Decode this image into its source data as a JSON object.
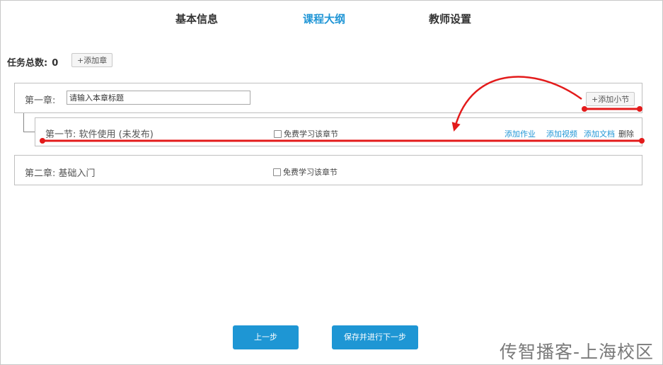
{
  "tabs": {
    "basic": "基本信息",
    "outline": "课程大纲",
    "teacher": "教师设置"
  },
  "summary": {
    "label": "任务总数:",
    "count": "0",
    "add_chapter": "+添加章"
  },
  "chapter1": {
    "label": "第一章:",
    "title_placeholder": "请输入本章标题",
    "add_section": "+添加小节"
  },
  "section1": {
    "label": "第一节: 软件使用  (未发布)",
    "free_label": "免费学习该章节",
    "actions": {
      "add_homework": "添加作业",
      "add_video": "添加视频",
      "add_document": "添加文档",
      "delete": "删除"
    }
  },
  "chapter2": {
    "label": "第二章: 基础入门",
    "free_label": "免费学习该章节"
  },
  "footer": {
    "prev": "上一步",
    "save_next": "保存并进行下一步"
  },
  "watermark": "传智播客-上海校区",
  "colors": {
    "accent": "#2196d6",
    "button_blue": "#1e96d4",
    "annotation_red": "#e31b1b"
  }
}
